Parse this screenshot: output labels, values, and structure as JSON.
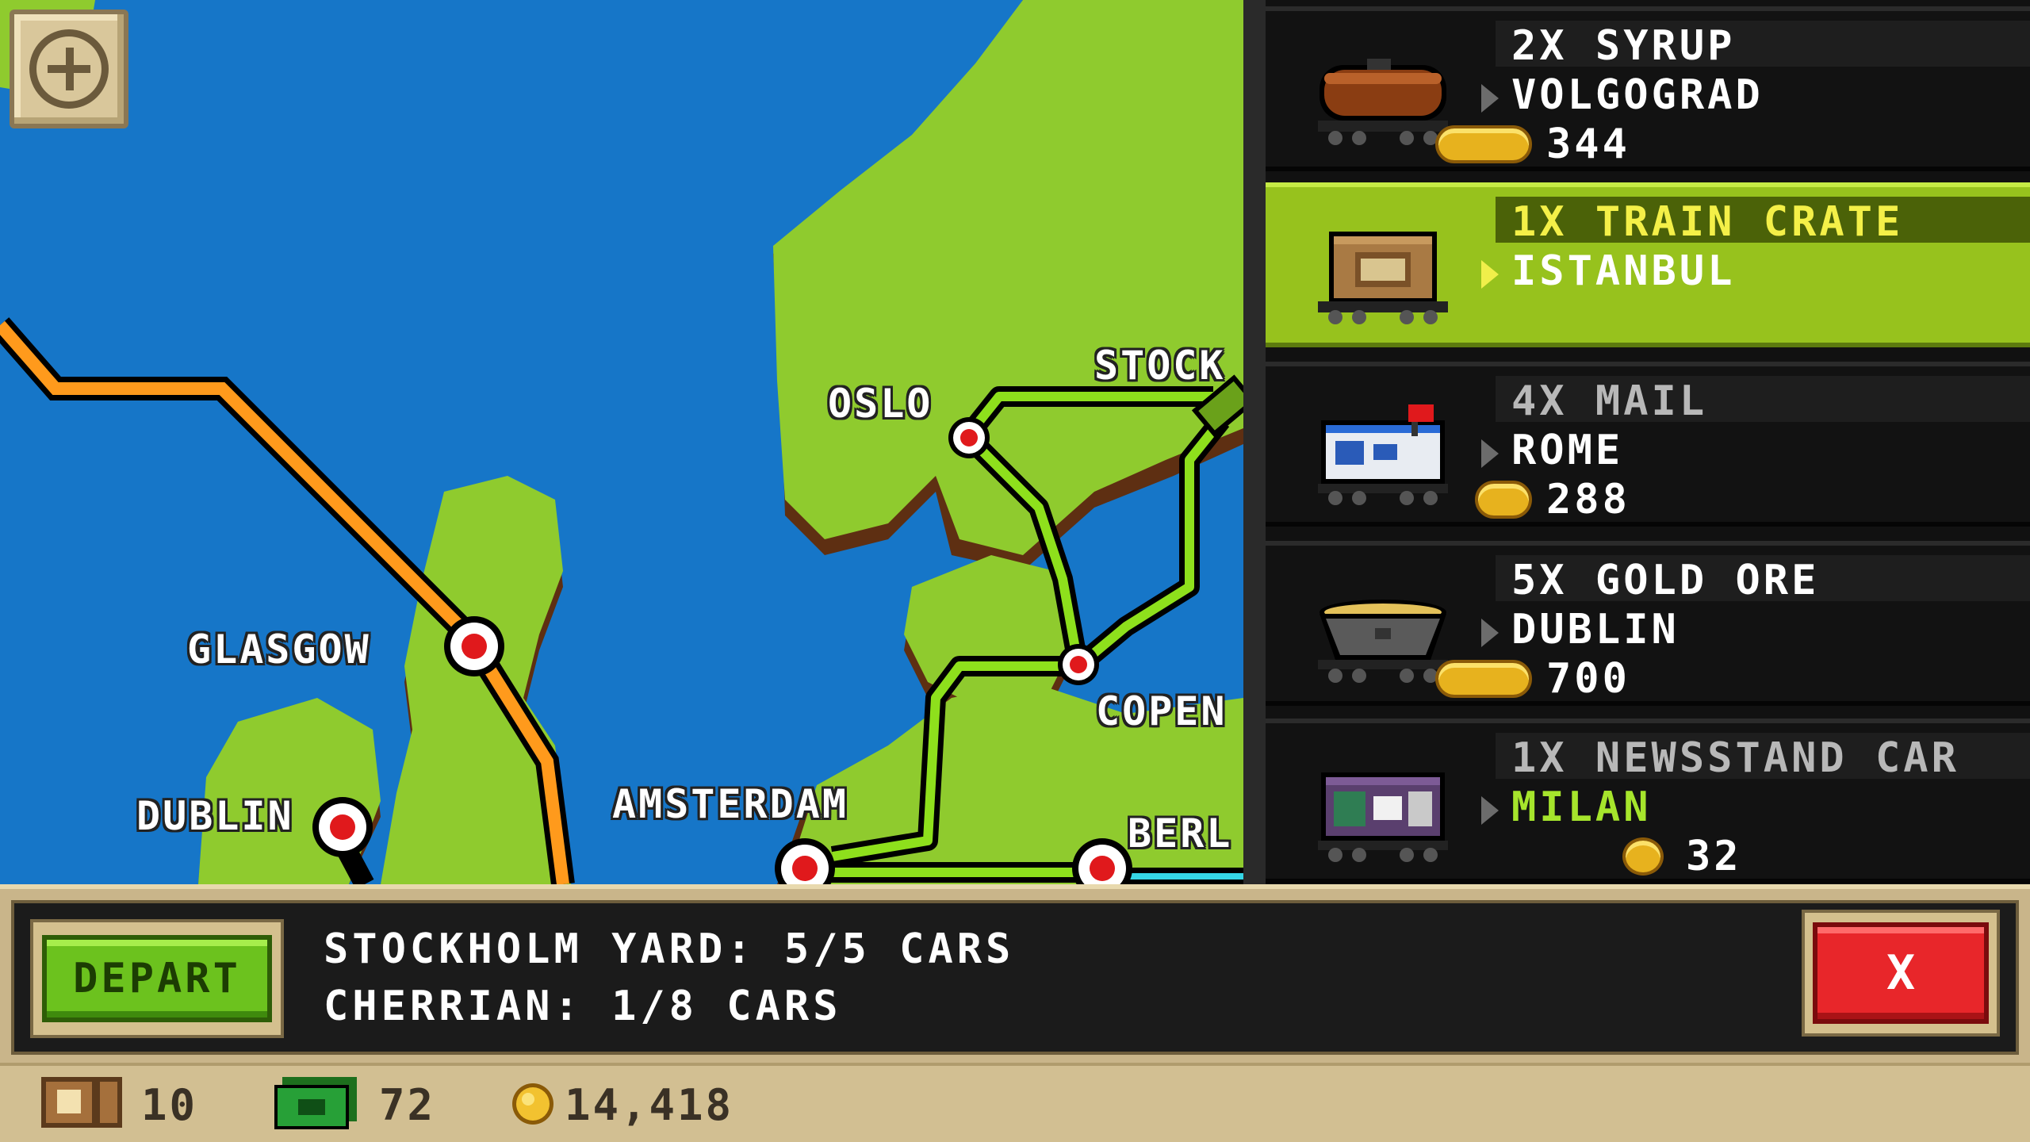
{
  "map": {
    "cities": [
      {
        "name": "GLASGOW"
      },
      {
        "name": "DUBLIN"
      },
      {
        "name": "AMSTERDAM"
      },
      {
        "name": "OSLO"
      },
      {
        "name": "STOCK"
      },
      {
        "name": "COPEN"
      },
      {
        "name": "BERL"
      }
    ],
    "zoom_icon": "zoom-in-icon"
  },
  "cargo": [
    {
      "title": "2X SYRUP",
      "destination": "VOLGOGRAD",
      "reward": "344",
      "car_icon": "tank-car-icon",
      "selected": false
    },
    {
      "title": "1X TRAIN CRATE",
      "destination": "ISTANBUL",
      "reward": "",
      "car_icon": "crate-car-icon",
      "selected": true
    },
    {
      "title": "4X MAIL",
      "destination": "ROME",
      "reward": "288",
      "car_icon": "mail-car-icon",
      "selected": false
    },
    {
      "title": "5X GOLD ORE",
      "destination": "DUBLIN",
      "reward": "700",
      "car_icon": "ore-hopper-icon",
      "selected": false
    },
    {
      "title": "1X NEWSSTAND CAR",
      "destination": "MILAN",
      "reward": "32",
      "car_icon": "newsstand-car-icon",
      "selected": false
    }
  ],
  "dialog": {
    "depart_label": "DEPART",
    "line1": "STOCKHOLM YARD: 5/5 CARS",
    "line2": "CHERRIAN: 1/8 CARS",
    "close_label": "X"
  },
  "status": {
    "crates": "10",
    "bux": "72",
    "coins": "14,418"
  },
  "colors": {
    "water": "#1676c8",
    "land": "#8fcb2e",
    "route_orange": "#ff9a1c",
    "route_green": "#8ee01c",
    "selected_row": "#97c21d"
  }
}
